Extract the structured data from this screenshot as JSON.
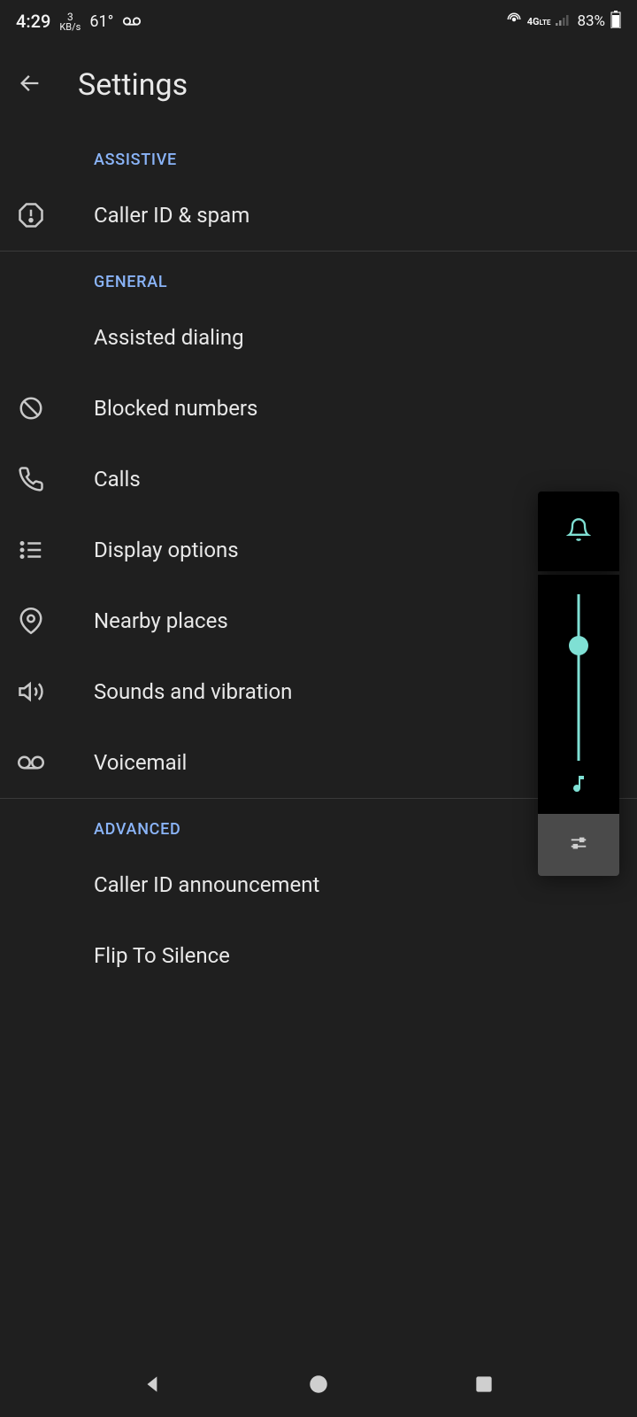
{
  "status": {
    "time": "4:29",
    "kbs_top": "3",
    "kbs_bottom": "KB/s",
    "temp": "61°",
    "network": "4G",
    "battery": "83%"
  },
  "appbar": {
    "title": "Settings"
  },
  "sections": {
    "assistive": {
      "header": "ASSISTIVE",
      "caller_id_spam": "Caller ID & spam"
    },
    "general": {
      "header": "GENERAL",
      "assisted_dialing": "Assisted dialing",
      "blocked_numbers": "Blocked numbers",
      "calls": "Calls",
      "display_options": "Display options",
      "nearby_places": "Nearby places",
      "sounds_vibration": "Sounds and vibration",
      "voicemail": "Voicemail"
    },
    "advanced": {
      "header": "ADVANCED",
      "caller_id_announcement": "Caller ID announcement",
      "flip_to_silence": "Flip To Silence"
    }
  },
  "volume_panel": {
    "mode": "ring",
    "stream": "media"
  }
}
